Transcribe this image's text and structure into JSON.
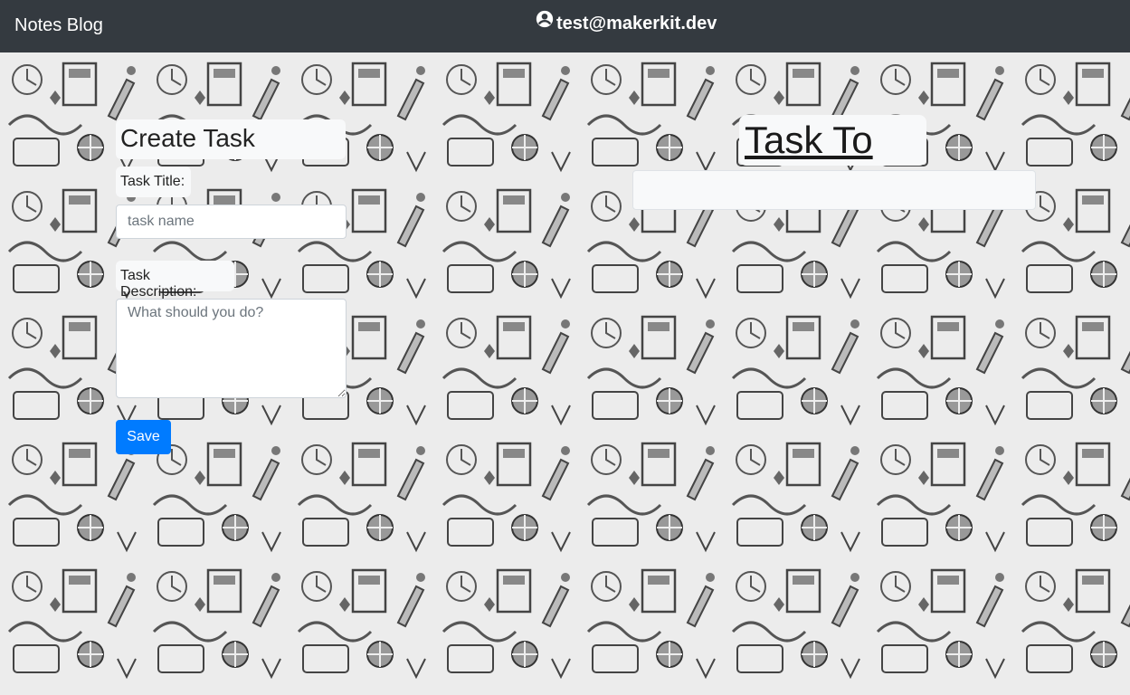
{
  "navbar": {
    "brand": "Notes Blog",
    "user_email": "test@makerkit.dev",
    "user_icon": "user-circle-icon",
    "bg_color": "#343a40"
  },
  "create_task": {
    "heading": "Create Task",
    "title_label": "Task Title:",
    "title_placeholder": "task name",
    "title_value": "",
    "description_label": "Task Description:",
    "description_placeholder": "What should you do?",
    "description_value": "",
    "save_label": "Save",
    "save_color": "#007bff"
  },
  "todo": {
    "heading": "Task To Do",
    "items": []
  },
  "background": {
    "description_icon": "back-to-school-doodle-pattern"
  }
}
